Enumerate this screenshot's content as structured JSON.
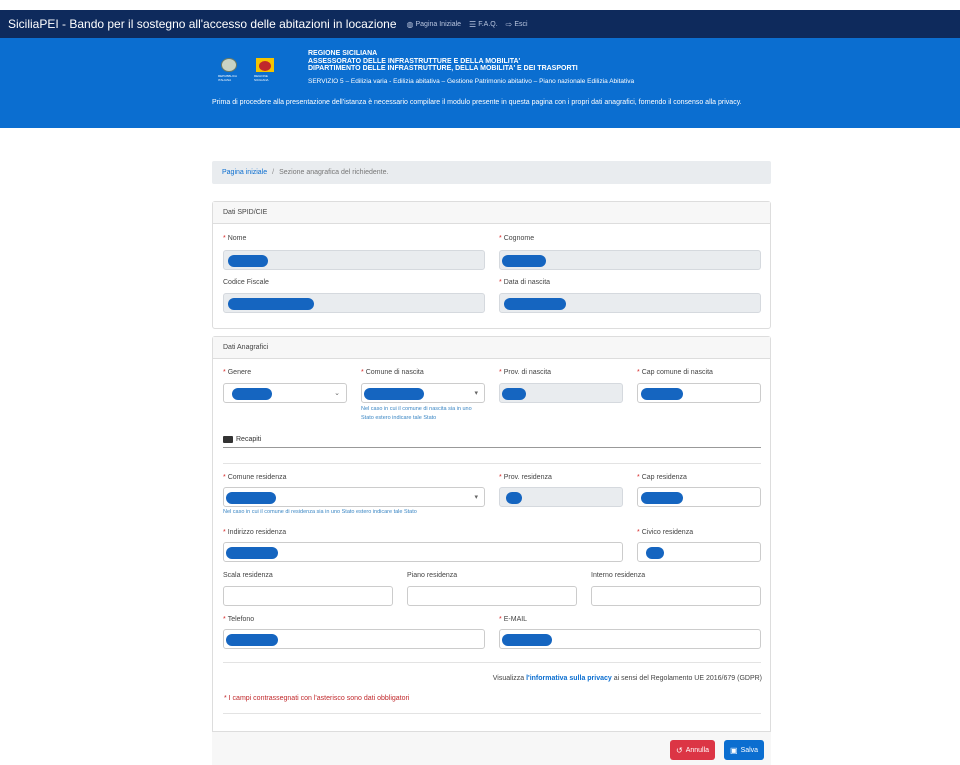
{
  "topbar": {
    "brand": "SiciliaPEI - Bando per il sostegno all'accesso delle abitazioni in locazione",
    "nav": [
      {
        "icon": "dashboard-icon",
        "glyph": "◍",
        "label": "Pagina Iniziale"
      },
      {
        "icon": "list-icon",
        "glyph": "☰",
        "label": "F.A.Q."
      },
      {
        "icon": "logout-icon",
        "glyph": "⇨",
        "label": "Esci"
      }
    ]
  },
  "header": {
    "logo1_caption": "REPUBBLICA ITALIANA",
    "logo2_caption": "REGIONE SICILIANA",
    "lines": [
      "REGIONE SICILIANA",
      "ASSESSORATO DELLE INFRASTRUTTURE E DELLA MOBILITA'",
      "DIPARTIMENTO DELLE INFRASTRUTTURE, DELLA MOBILITA' E DEI TRASPORTI"
    ],
    "service": "SERVIZIO 5 – Edilizia varia - Edilizia abitativa – Gestione Patrimonio abitativo – Piano nazionale Edilizia Abitativa",
    "intro": "Prima di procedere alla presentazione dell'istanza è necessario compilare il modulo presente in questa pagina con i propri dati anagrafici, fornendo il consenso alla privacy."
  },
  "breadcrumb": {
    "home": "Pagina iniziale",
    "separator": "/",
    "current": "Sezione anagrafica del richiedente."
  },
  "spid": {
    "title": "Dati SPID/CIE",
    "nome": "Nome",
    "cognome": "Cognome",
    "codice_fiscale": "Codice Fiscale",
    "data_nascita": "Data di nascita"
  },
  "anagrafici": {
    "title": "Dati Anagrafici",
    "genere": "Genere",
    "comune_nascita": "Comune di nascita",
    "prov_nascita": "Prov. di nascita",
    "cap_nascita": "Cap comune di nascita",
    "help_nascita": "Nel caso in cui il comune di nascita sia in uno Stato estero indicare tale Stato"
  },
  "recapiti": {
    "title": "Recapiti",
    "comune_residenza": "Comune residenza",
    "prov_residenza": "Prov. residenza",
    "cap_residenza": "Cap residenza",
    "help_residenza": "Nel caso in cui il comune di residenza sia in uno Stato estero indicare tale Stato",
    "indirizzo": "Indirizzo residenza",
    "civico": "Civico residenza",
    "scala": "Scala residenza",
    "piano": "Piano residenza",
    "interno": "Interno residenza",
    "telefono": "Telefono",
    "email": "E-MAIL"
  },
  "required_mark": "*",
  "privacy": {
    "prefix": "Visualizza",
    "link": "l'informativa sulla privacy",
    "suffix": "ai sensi del Regolamento UE 2016/679 (GDPR)"
  },
  "required_note": "* I campi contrassegnati con l'asterisco sono dati obbligatori",
  "buttons": {
    "cancel": "Annulla",
    "save": "Salva"
  },
  "colors": {
    "nav_bg": "#0e2a5c",
    "header_bg": "#0b6ed0",
    "redaction": "#1565c0",
    "danger": "#dc3545"
  }
}
